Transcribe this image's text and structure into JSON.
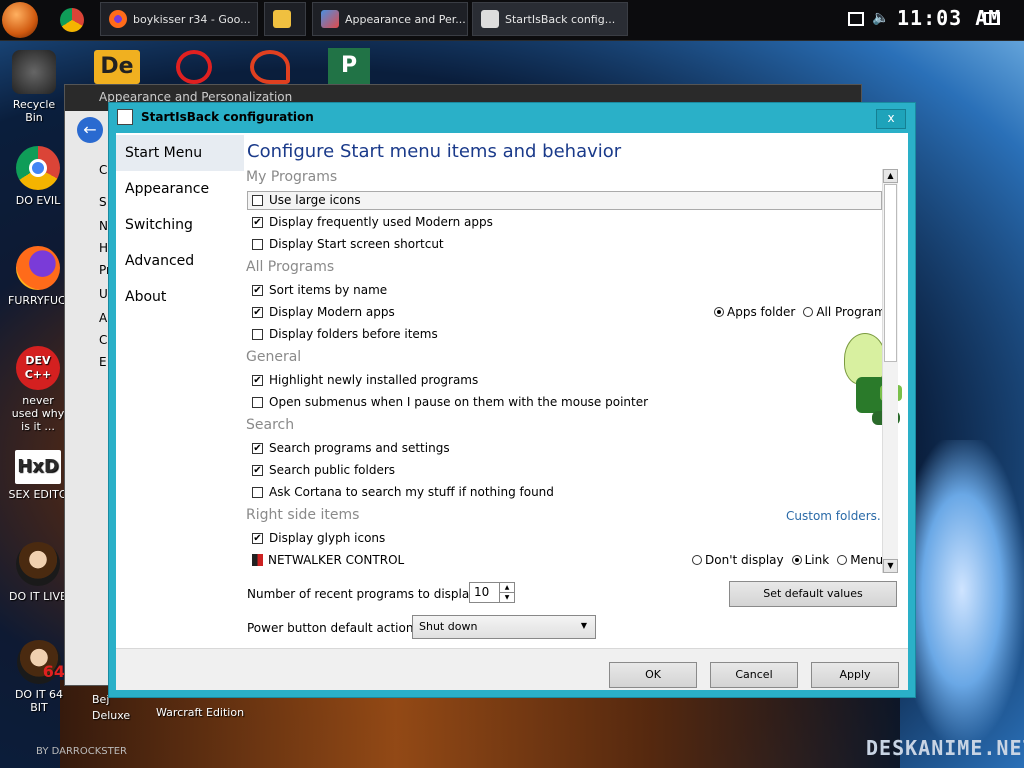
{
  "taskbar": {
    "tasks": [
      {
        "label": "boykisser r34 - Goo..."
      },
      {
        "label": ""
      },
      {
        "label": "Appearance and Per..."
      },
      {
        "label": "StartIsBack config..."
      }
    ],
    "clock": "11:03 AM"
  },
  "desktop": {
    "icons": [
      {
        "label": "Recycle Bin"
      },
      {
        "label": "DO EVIL"
      },
      {
        "label": "FURRYFUCK"
      },
      {
        "label": "never used why is it ..."
      },
      {
        "label": "SEX EDITO"
      },
      {
        "label": "DO IT LIVE"
      },
      {
        "label": "DO IT 64 BIT"
      }
    ],
    "dev_icon_text": "DEV C++",
    "bottom_labels": [
      "Bej Deluxe",
      "Warcraft Edition"
    ],
    "badge_64": "64",
    "watermark": "DESKANIME.NET",
    "credit": "BY DARROCKSTER"
  },
  "bg_window": {
    "title": "Appearance and Personalization",
    "sidebar_letters": [
      "C",
      "S",
      "N",
      "H",
      "Pr",
      "U",
      "A",
      "C",
      "E"
    ]
  },
  "dialog": {
    "title": "StartIsBack configuration",
    "close": "x",
    "nav": [
      "Start Menu",
      "Appearance",
      "Switching",
      "Advanced",
      "About"
    ],
    "heading": "Configure Start menu items and behavior",
    "sections": {
      "my_programs": "My Programs",
      "all_programs": "All Programs",
      "general": "General",
      "search": "Search",
      "right_side": "Right side items"
    },
    "options": {
      "use_large_icons": {
        "label": "Use large icons",
        "checked": false
      },
      "freq_modern": {
        "label": "Display frequently used Modern apps",
        "checked": true
      },
      "start_screen_shortcut": {
        "label": "Display Start screen shortcut",
        "checked": false
      },
      "sort_by_name": {
        "label": "Sort items by name",
        "checked": true
      },
      "modern_apps": {
        "label": "Display Modern apps",
        "checked": true
      },
      "folders_before": {
        "label": "Display folders before items",
        "checked": false
      },
      "highlight_new": {
        "label": "Highlight newly installed programs",
        "checked": true
      },
      "open_submenus": {
        "label": "Open submenus when I pause on them with the mouse pointer",
        "checked": false
      },
      "search_programs": {
        "label": "Search programs and settings",
        "checked": true
      },
      "search_public": {
        "label": "Search public folders",
        "checked": true
      },
      "ask_cortana": {
        "label": "Ask Cortana to search my stuff if nothing found",
        "checked": false
      },
      "glyph_icons": {
        "label": "Display glyph icons",
        "checked": true
      }
    },
    "modern_radio": {
      "apps_folder": "Apps folder",
      "all_programs": "All Programs",
      "selected": "apps_folder"
    },
    "netwalker": {
      "label": "NETWALKER CONTROL",
      "dont_display": "Don't display",
      "link": "Link",
      "menu": "Menu",
      "selected": "link"
    },
    "custom_folders": "Custom folders...",
    "recent_label": "Number of recent programs to display:",
    "recent_value": "10",
    "set_default": "Set default values",
    "power_label": "Power button default action:",
    "power_value": "Shut down",
    "ok": "OK",
    "cancel": "Cancel",
    "apply": "Apply"
  },
  "colors": {
    "dialog_frame": "#2ab0c8",
    "heading": "#1a3a8a",
    "link": "#2a6aa8"
  }
}
